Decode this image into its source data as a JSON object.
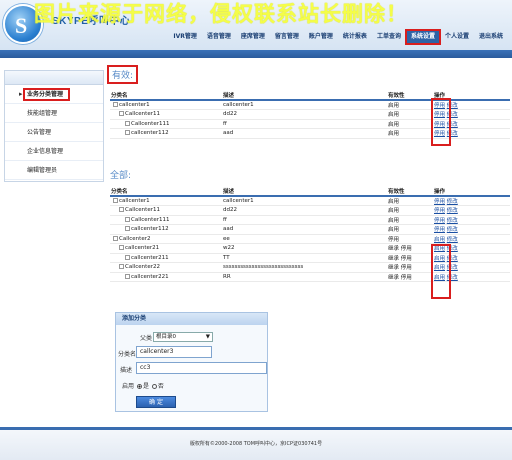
{
  "watermark": "图片来源于网络，侵权联系站长删除！",
  "brand": {
    "logo_letter": "S",
    "name": "SKYPE呼叫中心"
  },
  "nav": [
    "IVR管理",
    "语音管理",
    "座席管理",
    "留言管理",
    "账户管理",
    "统计报表",
    "工单查询",
    "系统设置",
    "个人设置",
    "退出系统"
  ],
  "nav_active": "系统设置",
  "sidebar": [
    "业务分类管理",
    "技能组管理",
    "公告管理",
    "企业信息管理",
    "编辑管理员"
  ],
  "sidebar_active": "业务分类管理",
  "columns": [
    "分类名",
    "描述",
    "有效性",
    "操作"
  ],
  "valid_section": {
    "title": "有效:",
    "rows": [
      {
        "name": "callcenter1",
        "desc": "callcenter1",
        "status": "启用",
        "op1": "停用",
        "op2": "修改",
        "level": 0
      },
      {
        "name": "Callcenter11",
        "desc": "dd22",
        "status": "启用",
        "op1": "停用",
        "op2": "修改",
        "level": 1
      },
      {
        "name": "Callcenter111",
        "desc": "ff",
        "status": "启用",
        "op1": "停用",
        "op2": "修改",
        "level": 2
      },
      {
        "name": "callcenter112",
        "desc": "aad",
        "status": "启用",
        "op1": "停用",
        "op2": "修改",
        "level": 2
      }
    ]
  },
  "all_section": {
    "title": "全部:",
    "rows": [
      {
        "name": "callcenter1",
        "desc": "callcenter1",
        "status": "启用",
        "op1": "停用",
        "op2": "修改",
        "level": 0
      },
      {
        "name": "Callcenter11",
        "desc": "dd22",
        "status": "启用",
        "op1": "停用",
        "op2": "修改",
        "level": 1
      },
      {
        "name": "Callcenter111",
        "desc": "ff",
        "status": "启用",
        "op1": "停用",
        "op2": "修改",
        "level": 2
      },
      {
        "name": "callcenter112",
        "desc": "aad",
        "status": "启用",
        "op1": "停用",
        "op2": "修改",
        "level": 2
      },
      {
        "name": "Callcenter2",
        "desc": "ee",
        "status": "停用",
        "op1": "启用",
        "op2": "修改",
        "level": 0
      },
      {
        "name": "callcenter21",
        "desc": "w22",
        "status": "继承 停用",
        "op1": "启用",
        "op2": "修改",
        "level": 1
      },
      {
        "name": "callcenter211",
        "desc": "TT",
        "status": "继承 停用",
        "op1": "启用",
        "op2": "修改",
        "level": 2
      },
      {
        "name": "Callcenter22",
        "desc": "ssssssssssssssssssssssssssss",
        "status": "继承 停用",
        "op1": "启用",
        "op2": "修改",
        "level": 1
      },
      {
        "name": "callcenter221",
        "desc": "RR",
        "status": "继承 停用",
        "op1": "启用",
        "op2": "修改",
        "level": 2
      }
    ]
  },
  "form": {
    "title": "添加分类",
    "parent_label": "父类",
    "parent_value": "根目录0",
    "name_label": "分类名",
    "name_value": "callcenter3",
    "desc_label": "描述",
    "desc_value": "cc3",
    "enable_label": "启用",
    "yes": "是",
    "no": "否",
    "submit": "确 定"
  },
  "footer": "版权所有©2000-2008 TOM呼叫中心，京ICP证030741号",
  "colors": {
    "accent": "#2e63a6",
    "highlight": "#d91e1e",
    "link": "#1a4fa3"
  }
}
